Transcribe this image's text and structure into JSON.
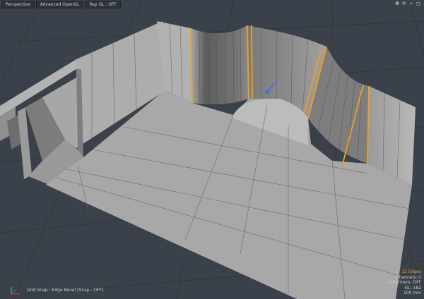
{
  "toolbar": {
    "view_mode": "Perspective",
    "render_mode": "Advanced OpenGL",
    "ray_gl": "Ray GL : OFF"
  },
  "nav_icons": [
    "move-view-icon",
    "rotate-view-icon",
    "zoom-view-icon",
    "maximize-view-icon"
  ],
  "status": {
    "text": "Grid Snap : Edge Bevel  [Snap : OFF]"
  },
  "info": {
    "edges": "12 Edges",
    "channels": "Channels: 0",
    "deformers": "Deformers: OFF",
    "gl": "GL: 182",
    "grid_size": "100 mm"
  },
  "colors": {
    "background": "#3b414a",
    "grid": "#2f343b",
    "floor": "#a8a8a8",
    "wall_light": "#b2b2b2",
    "wall_dark": "#707070",
    "selected_edge": "#f0a020",
    "handle": "#3c6ee6"
  }
}
